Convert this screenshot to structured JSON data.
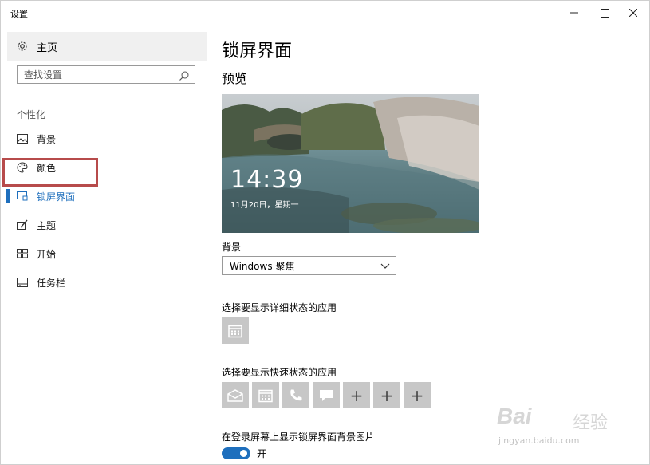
{
  "window": {
    "title": "设置"
  },
  "sidebar": {
    "home_label": "主页",
    "search_placeholder": "查找设置",
    "section_label": "个性化",
    "items": [
      {
        "label": "背景",
        "icon": "picture-icon"
      },
      {
        "label": "颜色",
        "icon": "palette-icon"
      },
      {
        "label": "锁屏界面",
        "icon": "lock-screen-icon",
        "active": true
      },
      {
        "label": "主题",
        "icon": "theme-icon"
      },
      {
        "label": "开始",
        "icon": "start-icon"
      },
      {
        "label": "任务栏",
        "icon": "taskbar-icon"
      }
    ]
  },
  "main": {
    "title": "锁屏界面",
    "preview_label": "预览",
    "preview_time": "14:39",
    "preview_date": "11月20日，星期一",
    "background_label": "背景",
    "background_value": "Windows 聚焦",
    "detail_label": "选择要显示详细状态的应用",
    "quick_label": "选择要显示快速状态的应用",
    "login_label": "在登录屏幕上显示锁屏界面背景图片",
    "toggle_state": "开"
  },
  "watermark": {
    "brand": "Bai",
    "brand2": "经验",
    "url": "jingyan.baidu.com"
  },
  "colors": {
    "accent": "#1e6fbd",
    "highlight": "#b74b4b",
    "tile": "#c7c7c7"
  }
}
